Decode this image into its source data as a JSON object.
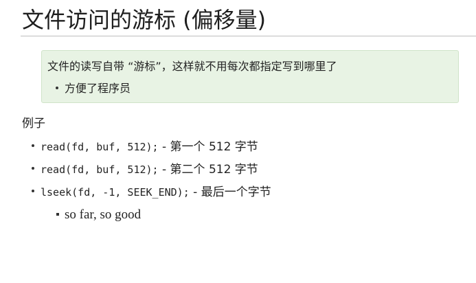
{
  "title": "文件访问的游标 (偏移量)",
  "callout": {
    "text": "文件的读写自带 “游标”，这样就不用每次都指定写到哪里了",
    "bullets": [
      "方便了程序员"
    ]
  },
  "example": {
    "heading": "例子",
    "items": [
      {
        "code": "read(fd, buf, 512);",
        "desc": " - 第一个 512 字节"
      },
      {
        "code": "read(fd, buf, 512);",
        "desc": " - 第二个 512 字节"
      },
      {
        "code": "lseek(fd, -1, SEEK_END);",
        "desc": " - 最后一个字节"
      }
    ],
    "sub_item": "so far, so good"
  }
}
